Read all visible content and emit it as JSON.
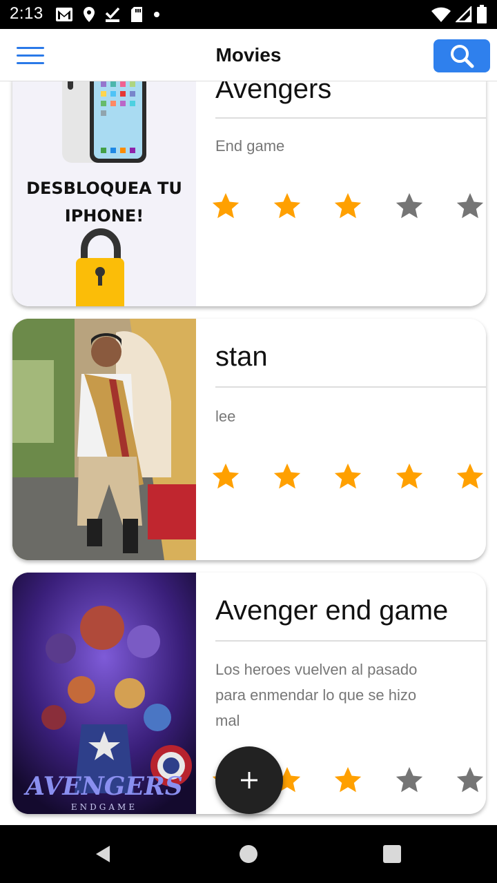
{
  "status_bar": {
    "time": "2:13",
    "icons": [
      "gmail-icon",
      "location-icon",
      "download-done-icon",
      "sd-card-icon",
      "dot-icon",
      "wifi-icon",
      "signal-icon",
      "battery-icon"
    ]
  },
  "app_bar": {
    "title": "Movies",
    "menu_icon": "hamburger-menu-icon",
    "search_icon": "search-icon"
  },
  "colors": {
    "accent": "#2f80ed",
    "star_on": "#ffa000",
    "star_off": "#757575",
    "fab": "#222222"
  },
  "movies": [
    {
      "title": "Avengers",
      "description": "End game",
      "rating": 3,
      "max_rating": 5,
      "poster": "unlock-iphone-ad",
      "poster_text": "DESBLOQUEA TU IPHONE!"
    },
    {
      "title": "stan",
      "description": "lee",
      "rating": 5,
      "max_rating": 5,
      "poster": "person-in-costume-photo"
    },
    {
      "title": "Avenger end game",
      "description": "Los heroes vuelven al pasado para enmendar lo que se hizo mal",
      "rating": 3,
      "max_rating": 5,
      "poster": "avengers-endgame-poster",
      "poster_text": "AVENGERS ENDGAME"
    }
  ],
  "fab": {
    "icon": "plus-icon"
  },
  "nav_bar": {
    "icons": [
      "back-icon",
      "home-icon",
      "recents-icon"
    ]
  }
}
